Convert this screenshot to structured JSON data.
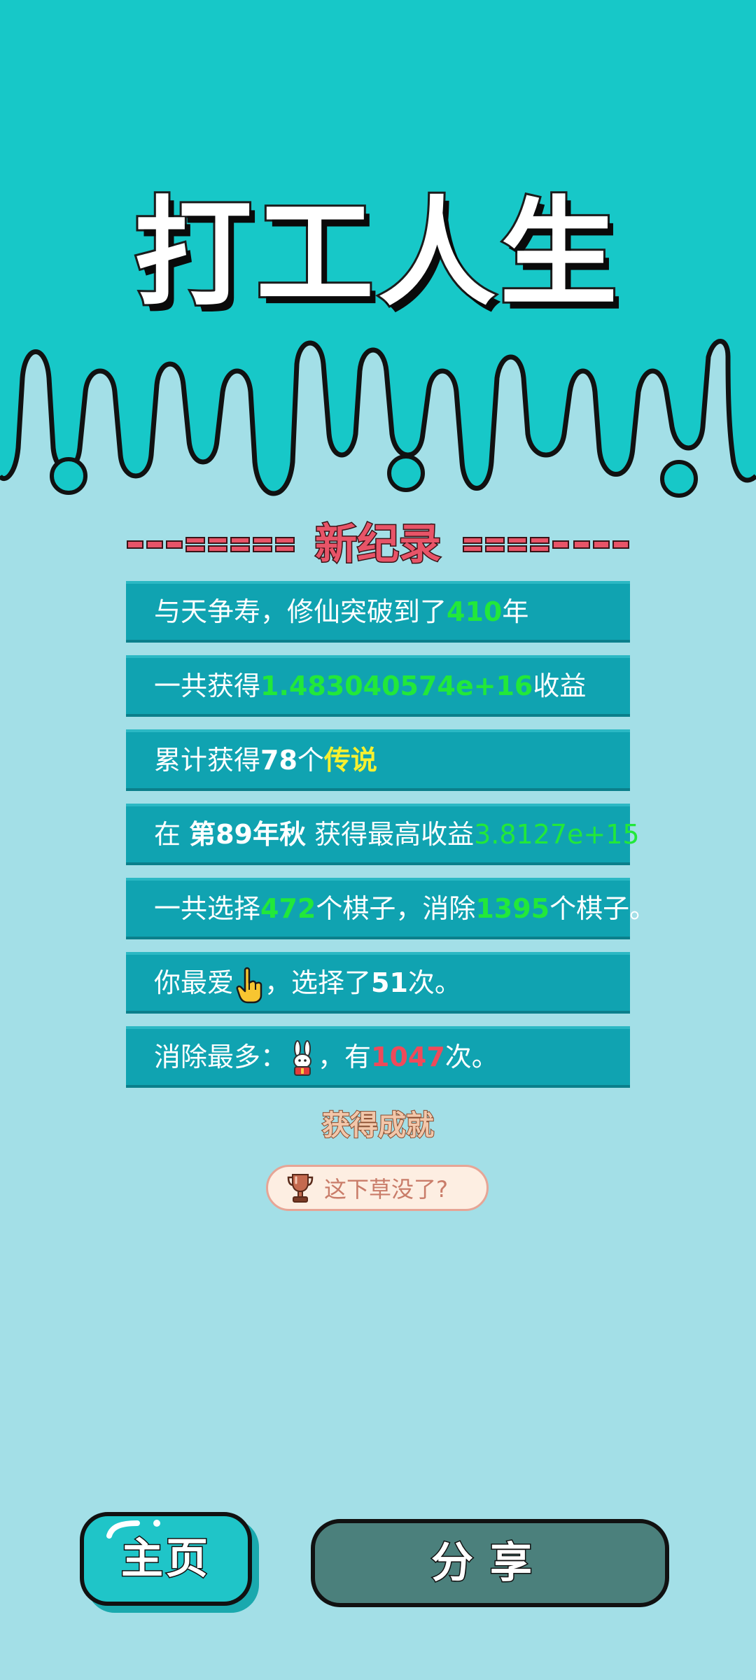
{
  "title": "打工人生",
  "record": {
    "title": "新纪录",
    "left_decor": "---====",
    "right_decor": "====---"
  },
  "stats": {
    "row1": {
      "prefix": "与天争寿，修仙突破到了",
      "value": "410",
      "suffix": "年"
    },
    "row2": {
      "prefix": "一共获得",
      "value": "1.483040574e+16",
      "suffix": "收益"
    },
    "row3": {
      "prefix": "累计获得",
      "count": "78",
      "mid": "个",
      "tier": "传说"
    },
    "row4": {
      "prefix": "在 ",
      "season": "第89年秋",
      "mid": " 获得最高收益",
      "value": "3.8127e+15"
    },
    "row5": {
      "prefix": "一共选择",
      "chosen": "472",
      "mid": "个棋子，消除",
      "removed": "1395",
      "suffix": "个棋子。"
    },
    "row6": {
      "prefix": "你最爱",
      "icon": "pointing-hand-icon",
      "mid": "，选择了",
      "count": "51",
      "suffix": "次。"
    },
    "row7": {
      "prefix": "消除最多：",
      "icon": "rabbit-icon",
      "mid": "，有",
      "count": "1047",
      "suffix": "次。"
    }
  },
  "achievements": {
    "title": "获得成就",
    "badge_icon": "trophy-icon",
    "badge_label": "这下草没了?"
  },
  "buttons": {
    "home": "主页",
    "share": "分享"
  },
  "colors": {
    "top_band": "#17c8c8",
    "background": "#a3dfe7",
    "row_bg": "#10a3b1",
    "highlight_green": "#22e83a",
    "highlight_yellow": "#f6f030",
    "highlight_red": "#ef4a5a",
    "record_title": "#e85468"
  }
}
